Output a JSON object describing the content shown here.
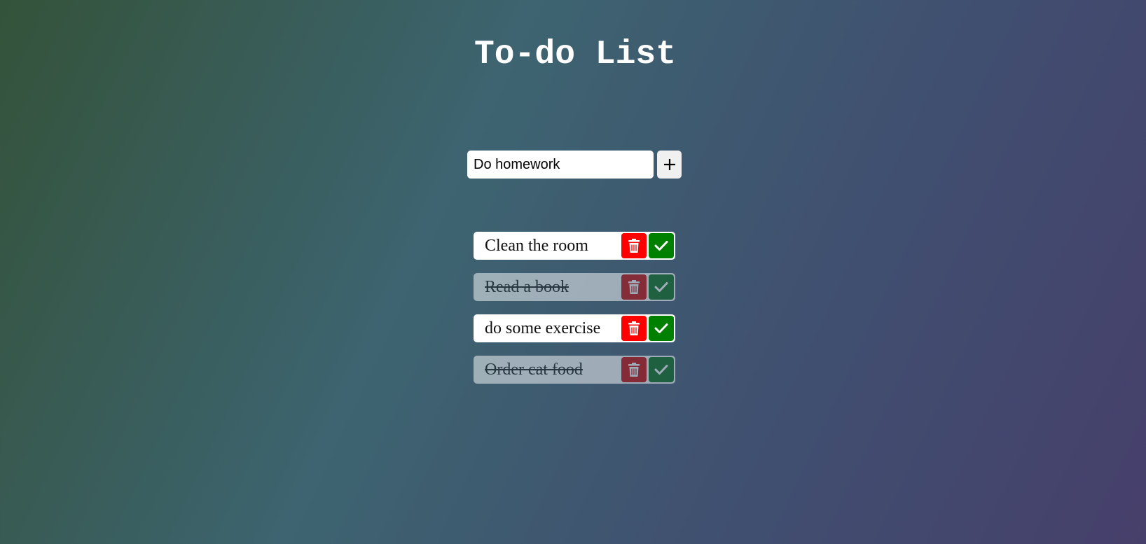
{
  "header": {
    "title": "To-do List"
  },
  "form": {
    "input_value": "Do homework",
    "add_icon": "plus-icon"
  },
  "todos": [
    {
      "text": "Clean the room",
      "completed": false
    },
    {
      "text": "Read a book",
      "completed": true
    },
    {
      "text": "do some exercise",
      "completed": false
    },
    {
      "text": "Order cat food",
      "completed": true
    }
  ],
  "icons": {
    "delete": "trash-icon",
    "complete": "check-icon"
  },
  "colors": {
    "delete": "#ff0000",
    "complete": "#008000",
    "text": "#ffffff"
  }
}
